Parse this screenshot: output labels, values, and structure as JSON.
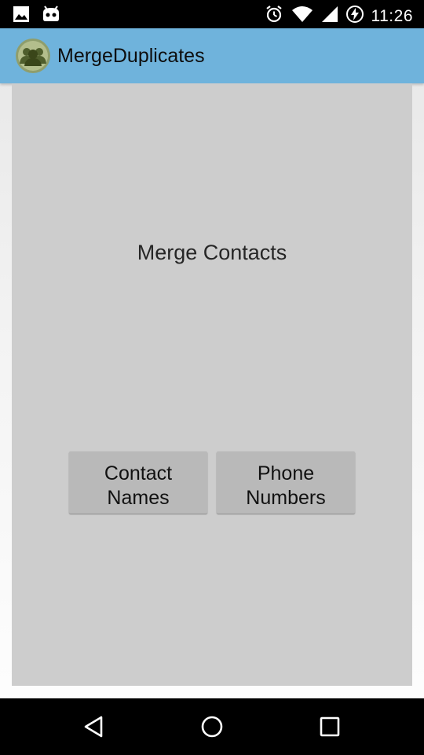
{
  "status_bar": {
    "time": "11:26",
    "icons": [
      "gallery-icon",
      "android-debug-icon",
      "alarm-icon",
      "wifi-icon",
      "signal-icon",
      "battery-charging-icon"
    ]
  },
  "app": {
    "title": "MergeDuplicates",
    "icon": "contacts-group-icon",
    "accent_color": "#6fb3dc"
  },
  "main": {
    "heading": "Merge Contacts",
    "buttons": [
      {
        "line1": "Contact",
        "line2": "Names"
      },
      {
        "line1": "Phone",
        "line2": "Numbers"
      }
    ]
  },
  "nav_bar": {
    "icons": [
      "back-icon",
      "home-icon",
      "recents-icon"
    ]
  }
}
